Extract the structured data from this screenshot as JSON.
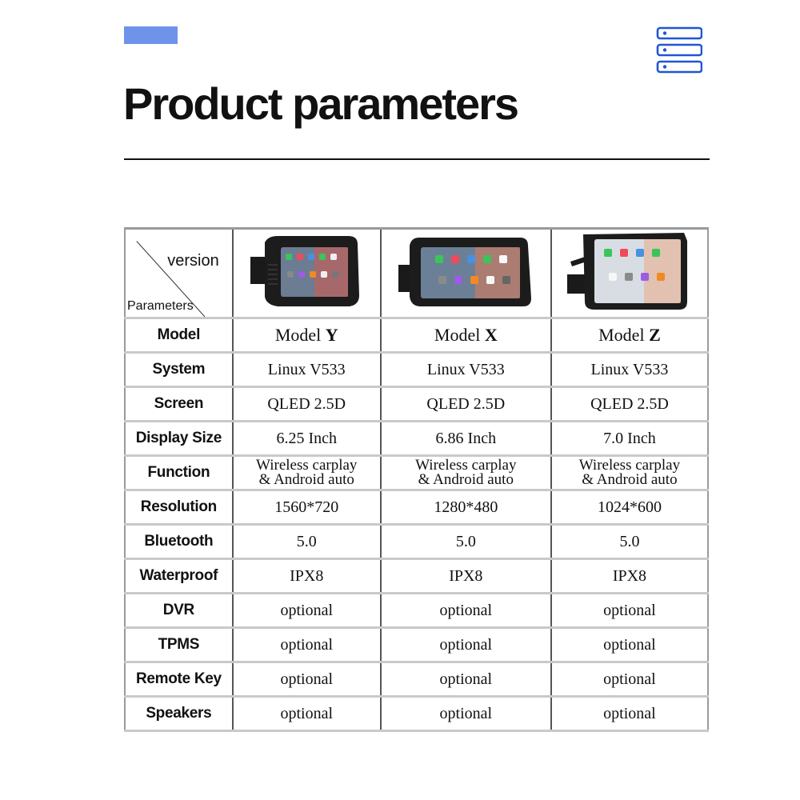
{
  "header": {
    "title": "Product parameters",
    "accent_color": "#6f93ea",
    "icon": "server-stack-icon",
    "icon_color": "#1f56d6"
  },
  "table": {
    "corner": {
      "top_label": "version",
      "bottom_label": "Parameters"
    },
    "models": [
      {
        "id": "Y",
        "prefix": "Model",
        "letter": "Y",
        "image": "device-image-model-y"
      },
      {
        "id": "X",
        "prefix": "Model",
        "letter": "X",
        "image": "device-image-model-x"
      },
      {
        "id": "Z",
        "prefix": "Model",
        "letter": "Z",
        "image": "device-image-model-z"
      }
    ],
    "model_row_label": "Model",
    "rows": [
      {
        "label": "System",
        "values": [
          "Linux V533",
          "Linux V533",
          "Linux V533"
        ]
      },
      {
        "label": "Screen",
        "values": [
          "QLED 2.5D",
          "QLED 2.5D",
          "QLED 2.5D"
        ]
      },
      {
        "label": "Display Size",
        "values": [
          "6.25 Inch",
          "6.86 Inch",
          "7.0 Inch"
        ]
      },
      {
        "label": "Function",
        "values": [
          [
            "Wireless carplay",
            "& Android auto"
          ],
          [
            "Wireless carplay",
            "& Android auto"
          ],
          [
            "Wireless carplay",
            "& Android auto"
          ]
        ]
      },
      {
        "label": "Resolution",
        "values": [
          "1560*720",
          "1280*480",
          "1024*600"
        ]
      },
      {
        "label": "Bluetooth",
        "values": [
          "5.0",
          "5.0",
          "5.0"
        ]
      },
      {
        "label": "Waterproof",
        "values": [
          "IPX8",
          "IPX8",
          "IPX8"
        ]
      },
      {
        "label": "DVR",
        "values": [
          "optional",
          "optional",
          "optional"
        ]
      },
      {
        "label": "TPMS",
        "values": [
          "optional",
          "optional",
          "optional"
        ]
      },
      {
        "label": "Remote Key",
        "values": [
          "optional",
          "optional",
          "optional"
        ]
      },
      {
        "label": "Speakers",
        "values": [
          "optional",
          "optional",
          "optional"
        ]
      }
    ]
  }
}
